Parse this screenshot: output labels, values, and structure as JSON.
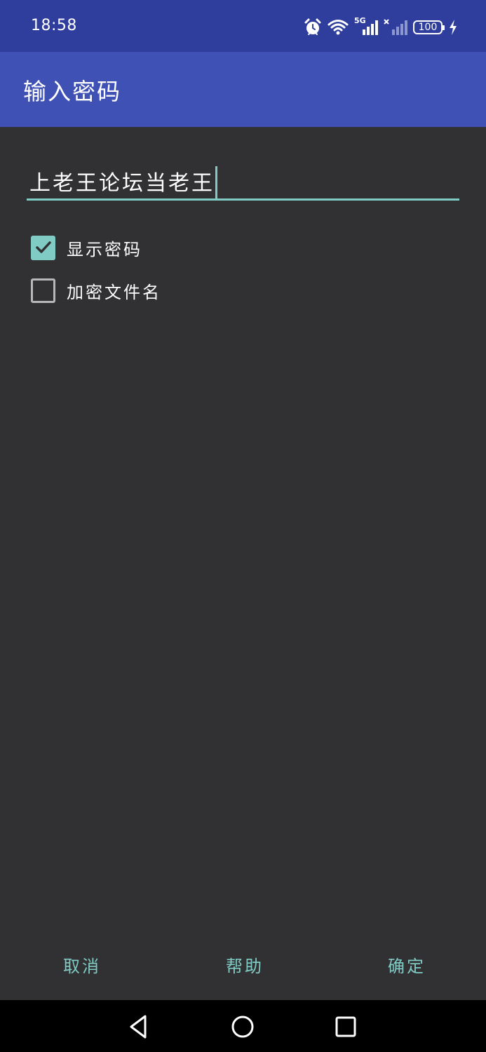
{
  "status_bar": {
    "time": "18:58",
    "icons": [
      "alarm-icon",
      "wifi-icon",
      "signal-5g-icon",
      "signal-no-service-icon",
      "battery-icon",
      "charging-icon"
    ],
    "network_label": "5G",
    "battery_level": "100"
  },
  "app_bar": {
    "title": "输入密码"
  },
  "password": {
    "value": "上老王论坛当老王"
  },
  "options": [
    {
      "label": "显示密码",
      "checked": true
    },
    {
      "label": "加密文件名",
      "checked": false
    }
  ],
  "dialog_buttons": {
    "cancel": "取消",
    "help": "帮助",
    "ok": "确定"
  },
  "nav_bar": {
    "icons": [
      "back-icon",
      "home-icon",
      "recents-icon"
    ]
  },
  "colors": {
    "status_bar": "#2f3e9d",
    "app_bar": "#3f51b5",
    "background": "#313033",
    "accent": "#80cbc4",
    "nav_bar": "#000000"
  }
}
